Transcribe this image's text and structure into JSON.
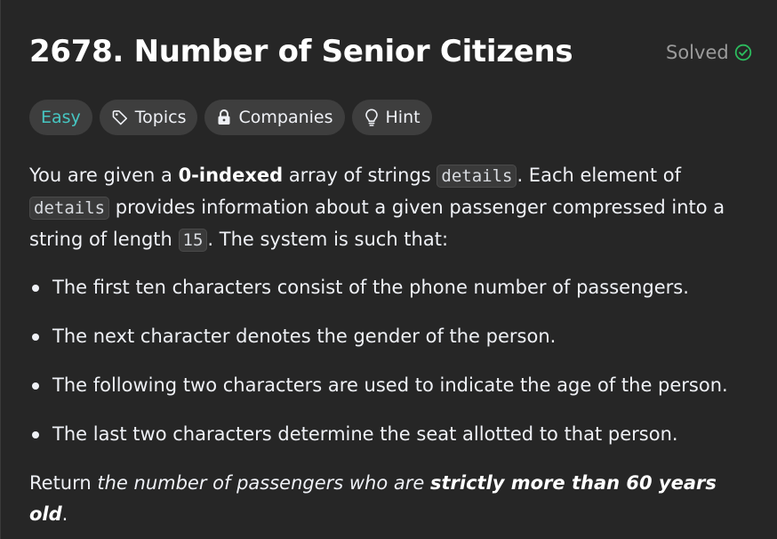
{
  "problem": {
    "title": "2678. Number of Senior Citizens",
    "status": "Solved"
  },
  "tags": [
    {
      "label": "Easy"
    },
    {
      "label": "Topics",
      "icon": "tag-icon"
    },
    {
      "label": "Companies",
      "icon": "lock-icon"
    },
    {
      "label": "Hint",
      "icon": "lightbulb-icon"
    }
  ],
  "description": {
    "p1": {
      "t1": "You are given a ",
      "b1": "0-indexed",
      "t2": " array of strings ",
      "c1": "details",
      "t3": ". Each element of ",
      "c2": "details",
      "t4": " provides information about a given passenger compressed into a string of length ",
      "c3": "15",
      "t5": ". The system is such that:"
    },
    "bullets": [
      "The first ten characters consist of the phone number of passengers.",
      "The next character denotes the gender of the person.",
      "The following two characters are used to indicate the age of the person.",
      "The last two characters determine the seat allotted to that person."
    ],
    "p2": {
      "t1": "Return ",
      "i1": "the number of passengers who are ",
      "b1": "strictly more than 60 years old",
      "t2": "."
    }
  },
  "colors": {
    "background": "#262626",
    "easy": "#46c6c2",
    "solved_check": "#2cbb5d",
    "tag_bg": "#3e3e3e"
  }
}
